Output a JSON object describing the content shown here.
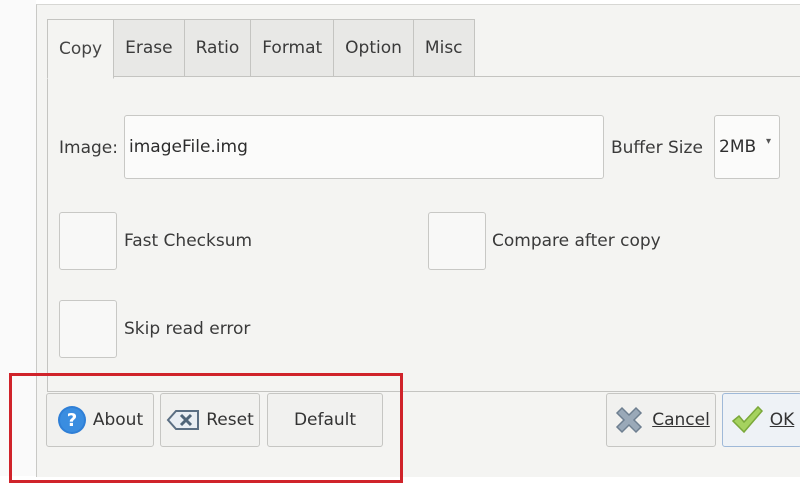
{
  "tabs": [
    {
      "label": "Copy"
    },
    {
      "label": "Erase"
    },
    {
      "label": "Ratio"
    },
    {
      "label": "Format"
    },
    {
      "label": "Option"
    },
    {
      "label": "Misc"
    }
  ],
  "image_field": {
    "label": "Image:",
    "value": "imageFile.img"
  },
  "buffer": {
    "label": "Buffer Size",
    "selected": "2MB"
  },
  "options": {
    "fast_checksum": {
      "label": "Fast Checksum",
      "checked": false
    },
    "compare_after_copy": {
      "label": "Compare after copy",
      "checked": false
    },
    "skip_read_error": {
      "label": "Skip read error",
      "checked": false
    }
  },
  "buttons": {
    "about": "About",
    "reset": "Reset",
    "default": "Default",
    "cancel": "Cancel",
    "ok": "OK"
  },
  "colors": {
    "highlight": "#d0232a",
    "about_icon": "#2f7fd6",
    "ok_check": "#8cc63f"
  },
  "icons": {
    "about": "help-icon",
    "reset": "backspace-x-icon",
    "cancel": "x-icon",
    "ok": "checkmark-icon"
  }
}
